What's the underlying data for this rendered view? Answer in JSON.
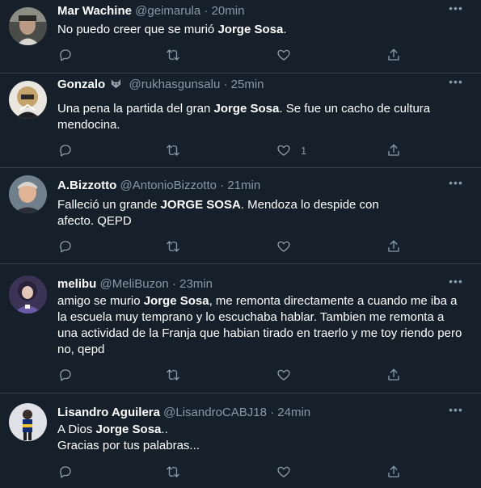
{
  "tweets": [
    {
      "name": "Mar Wachine",
      "handle": "@geimarula",
      "dot": "·",
      "time": "20min",
      "text_pre": "No puedo creer que se murió ",
      "text_bold": "Jorge Sosa",
      "text_post": ".",
      "like_count": "",
      "avatar_color": "#6d6f68"
    },
    {
      "name": "Gonzalo",
      "badge_icon": "wolf-emoji-icon",
      "handle": "@rukhasgunsalu",
      "dot": "·",
      "time": "25min",
      "text_pre": "Una pena la partida del gran ",
      "text_bold": "Jorge Sosa",
      "text_post": ". Se fue un cacho de cultura mendocina.",
      "like_count": "1",
      "avatar_color": "#b7a679"
    },
    {
      "name": "A.Bizzotto",
      "handle": "@AntonioBizzotto",
      "dot": "·",
      "time": "21min",
      "text_pre": "Falleció un grande ",
      "text_bold": "JORGE SOSA",
      "text_post": ". Mendoza lo despide con afecto. QEPD",
      "like_count": "",
      "avatar_color": "#7b8a95"
    },
    {
      "name": "melibu",
      "handle": "@MeliBuzon",
      "dot": "·",
      "time": "23min",
      "text_pre": "amigo se murio ",
      "text_bold": "Jorge Sosa",
      "text_post": ", me remonta directamente a cuando me iba a la escuela muy temprano y lo escuchaba hablar. Tambien me remonta a una actividad de la Franja que habian tirado en traerlo y me toy riendo pero no, qepd",
      "like_count": "",
      "avatar_color": "#5b4f83"
    },
    {
      "name": "Lisandro Aguilera",
      "handle": "@LisandroCABJ18",
      "dot": "·",
      "time": "24min",
      "text_pre": "A Dios ",
      "text_bold": "Jorge Sosa",
      "text_post": "..",
      "text_line2": "Gracias por tus palabras...",
      "like_count": "",
      "avatar_color": "#c9ccd3"
    }
  ],
  "icons": {
    "reply": "reply-icon",
    "retweet": "retweet-icon",
    "like": "like-icon",
    "share": "share-icon",
    "more": "more-options-icon"
  },
  "colors": {
    "background": "#15202b",
    "border": "#38444d",
    "secondary_text": "#8899a6",
    "primary_text": "#ffffff"
  }
}
